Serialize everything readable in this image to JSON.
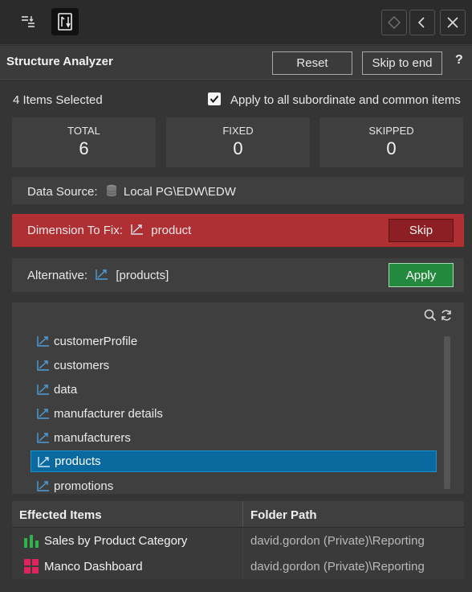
{
  "toolbar": {
    "left_icons": [
      "sort-list-icon",
      "structure-tool-icon"
    ],
    "right_icons": [
      "diamond-icon",
      "chevron-left-icon",
      "close-icon"
    ]
  },
  "header": {
    "title": "Structure Analyzer",
    "reset_label": "Reset",
    "skip_to_end_label": "Skip to end",
    "help_label": "?"
  },
  "selection": {
    "count_text": "4 Items Selected",
    "apply_all_label": "Apply to all subordinate and common items",
    "apply_all_checked": true
  },
  "stats": [
    {
      "label": "TOTAL",
      "value": "6"
    },
    {
      "label": "FIXED",
      "value": "0"
    },
    {
      "label": "SKIPPED",
      "value": "0"
    }
  ],
  "data_source": {
    "label": "Data Source:",
    "value": "Local PG\\EDW\\EDW",
    "icon": "database-icon"
  },
  "dimension": {
    "label": "Dimension To Fix:",
    "value": "product",
    "skip_label": "Skip",
    "icon": "dimension-icon"
  },
  "alternative": {
    "label": "Alternative:",
    "value": "[products]",
    "apply_label": "Apply",
    "icon": "dimension-icon"
  },
  "list": {
    "tools": [
      "search-icon",
      "refresh-icon"
    ],
    "items": [
      "customerProfile",
      "customers",
      "data",
      "manufacturer details",
      "manufacturers",
      "products",
      "promotions"
    ],
    "selected": "products"
  },
  "table": {
    "headers": [
      "Effected Items",
      "Folder Path"
    ],
    "rows": [
      {
        "name": "Sales by Product Category",
        "path": "david.gordon (Private)\\Reporting",
        "icon": "bar-chart-icon"
      },
      {
        "name": "Manco Dashboard",
        "path": "david.gordon (Private)\\Reporting",
        "icon": "dashboard-icon"
      }
    ]
  },
  "colors": {
    "background": "#353535",
    "panel": "#3f3f3f",
    "error_red": "#b02f33",
    "skip_red": "#8b1f24",
    "apply_green": "#22893d",
    "selected_blue": "#0a6aa0",
    "icon_blue": "#4a9fd8",
    "chart_green": "#2fb34a",
    "dashboard_pink": "#e0245e"
  }
}
